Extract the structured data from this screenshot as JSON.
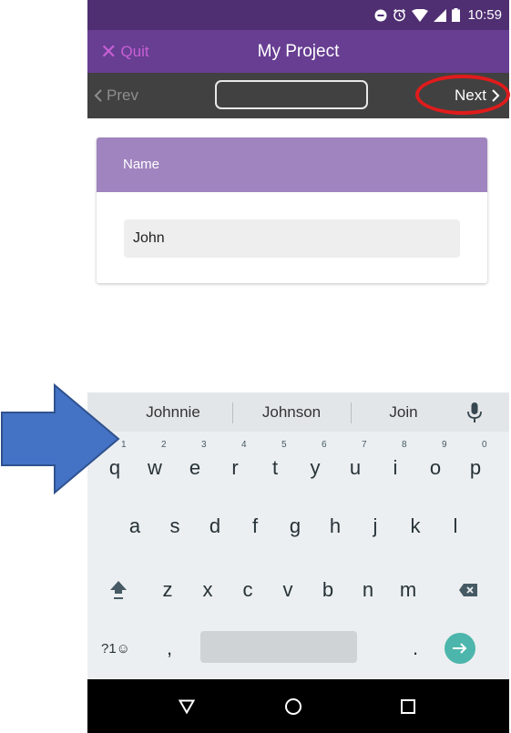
{
  "status_bar": {
    "time": "10:59",
    "icons": [
      "do-not-disturb-icon",
      "alarm-icon",
      "wifi-icon",
      "signal-icon",
      "battery-icon"
    ]
  },
  "app_bar": {
    "quit_label": "Quit",
    "title": "My Project"
  },
  "nav_bar": {
    "prev_label": "Prev",
    "next_label": "Next",
    "input_value": ""
  },
  "card": {
    "header": "Name",
    "field_value": "John"
  },
  "keyboard": {
    "suggestions": [
      "Johnnie",
      "Johnson",
      "Join"
    ],
    "row1": [
      "q",
      "w",
      "e",
      "r",
      "t",
      "y",
      "u",
      "i",
      "o",
      "p"
    ],
    "row1_hints": [
      "1",
      "2",
      "3",
      "4",
      "5",
      "6",
      "7",
      "8",
      "9",
      "0"
    ],
    "row2": [
      "a",
      "s",
      "d",
      "f",
      "g",
      "h",
      "j",
      "k",
      "l"
    ],
    "row3": [
      "z",
      "x",
      "c",
      "v",
      "b",
      "n",
      "m"
    ],
    "symbols_label": "?1☺",
    "comma_label": ",",
    "period_label": "."
  },
  "colors": {
    "status_bar": "#4f2f72",
    "app_bar": "#673e92",
    "nav_bar": "#414141",
    "card_header": "#a084bf",
    "quit": "#c85fd4",
    "enter_key": "#4db6ac",
    "annotation_red": "#e01b1b",
    "annotation_arrow": "#4472c4"
  }
}
